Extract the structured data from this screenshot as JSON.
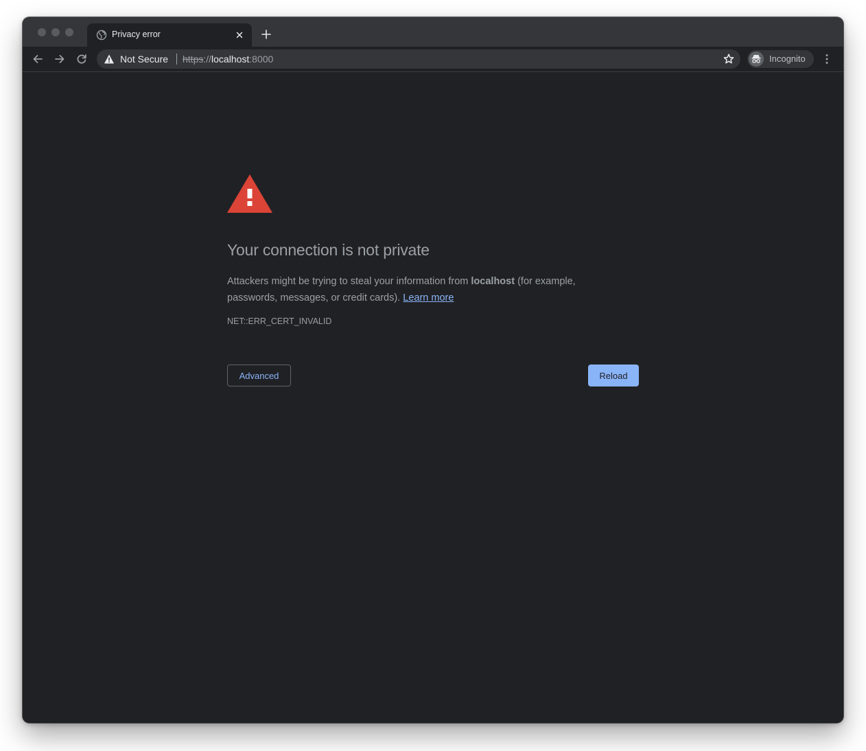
{
  "tab": {
    "title": "Privacy error"
  },
  "address_bar": {
    "security_label": "Not Secure",
    "url_scheme": "https",
    "url_scheme_separator": "://",
    "url_host": "localhost",
    "url_port": ":8000"
  },
  "profile": {
    "label": "Incognito"
  },
  "error_page": {
    "heading": "Your connection is not private",
    "description_before": "Attackers might be trying to steal your information from ",
    "description_host": "localhost",
    "description_after": " (for example, passwords, messages, or credit cards). ",
    "learn_more_label": "Learn more",
    "error_code": "NET::ERR_CERT_INVALID",
    "advanced_button_label": "Advanced",
    "reload_button_label": "Reload"
  },
  "colors": {
    "page_background": "#202124",
    "error_icon": "#db4437",
    "link": "#8ab4f8",
    "primary_button": "#8ab4f8",
    "text_secondary": "#9aa0a6"
  },
  "icons": {
    "tab_favicon": "globe-icon",
    "tab_close": "close-icon",
    "new_tab": "plus-icon",
    "back": "back-arrow-icon",
    "forward": "forward-arrow-icon",
    "reload": "reload-icon",
    "security": "warning-triangle-icon",
    "bookmark": "star-icon",
    "incognito": "incognito-icon",
    "menu": "kebab-menu-icon",
    "error": "error-triangle-icon"
  }
}
